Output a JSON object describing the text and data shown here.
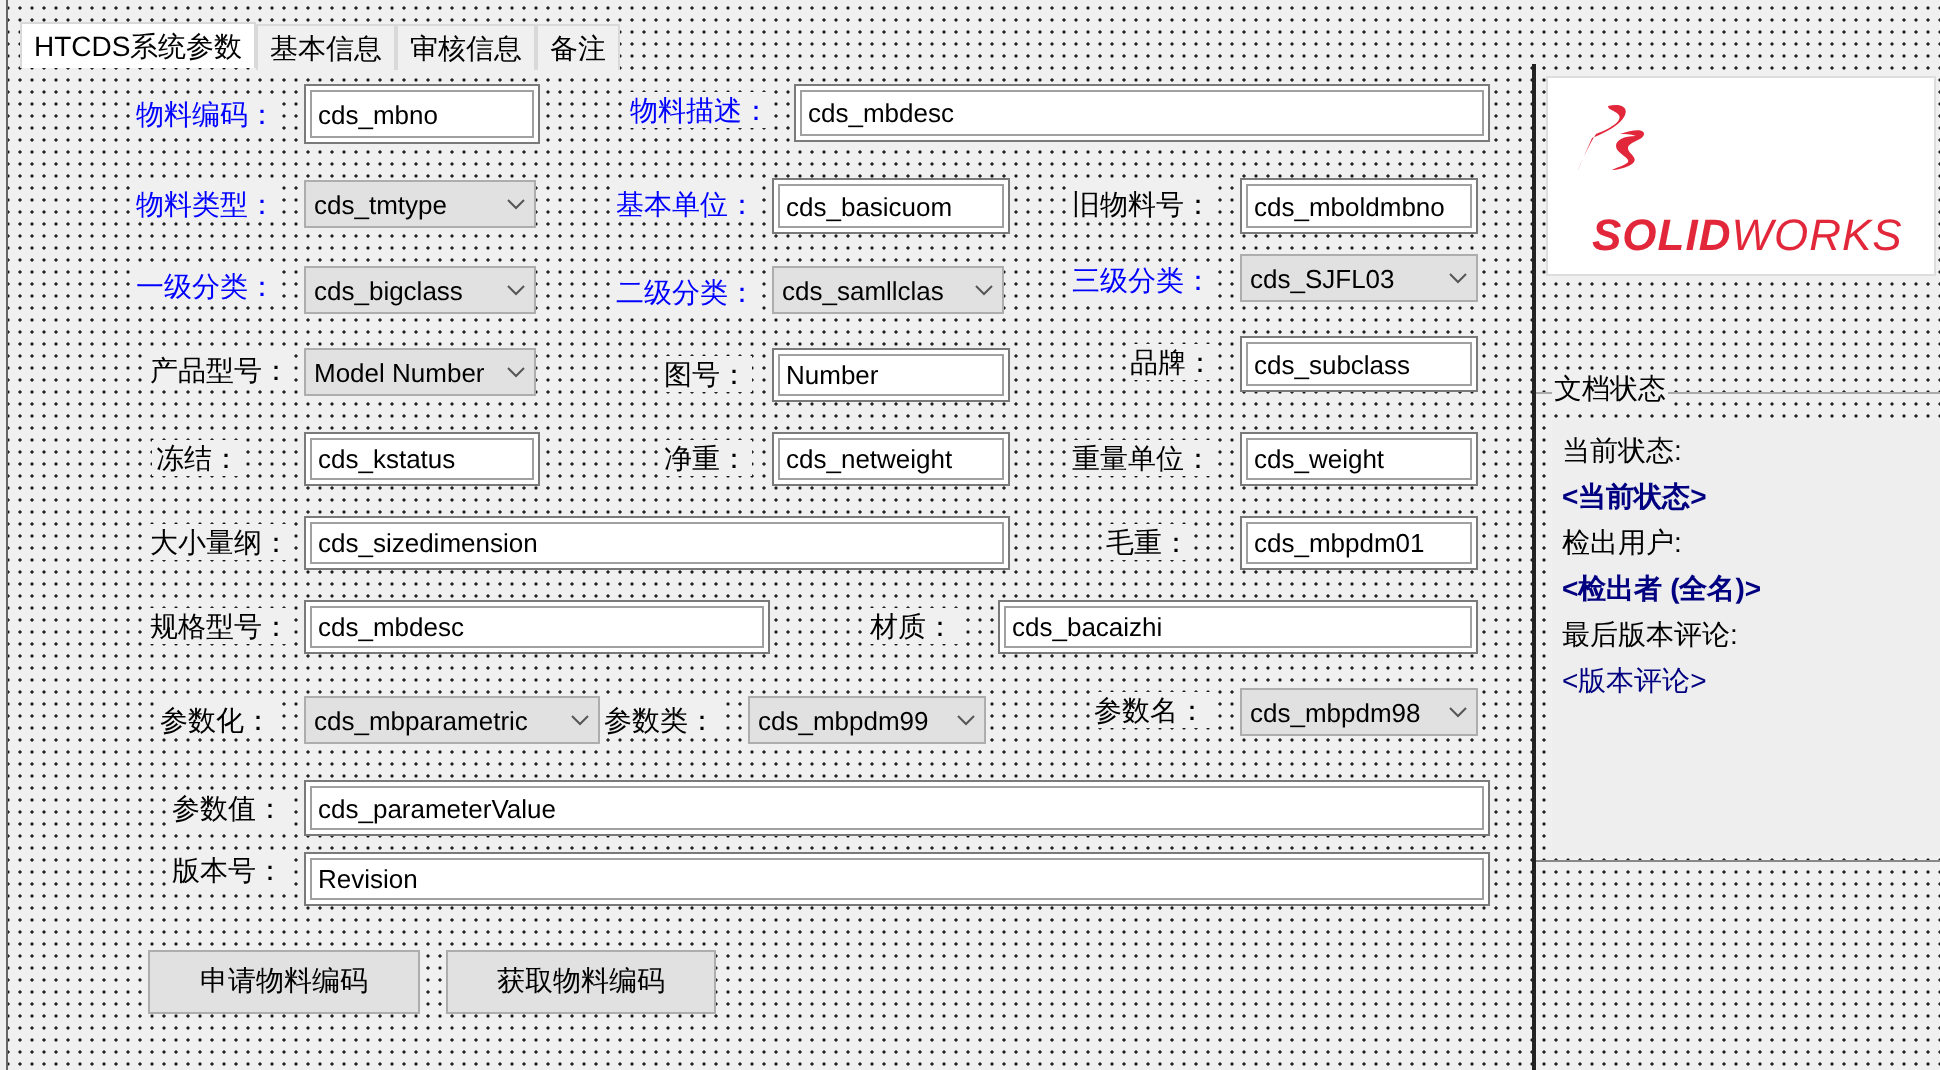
{
  "tabs": [
    {
      "label": "HTCDS系统参数",
      "selected": true
    },
    {
      "label": "基本信息",
      "selected": false
    },
    {
      "label": "审核信息",
      "selected": false
    },
    {
      "label": "备注",
      "selected": false
    }
  ],
  "fields": [
    {
      "label": "物料编码：",
      "required": true,
      "kind": "text",
      "value": "cds_mbno"
    },
    {
      "label": "物料描述：",
      "required": true,
      "kind": "text",
      "value": "cds_mbdesc"
    },
    {
      "label": "物料类型：",
      "required": true,
      "kind": "combo",
      "value": "cds_tmtype"
    },
    {
      "label": "基本单位：",
      "required": true,
      "kind": "text",
      "value": "cds_basicuom"
    },
    {
      "label": "旧物料号：",
      "required": false,
      "kind": "text",
      "value": "cds_mboldmbno"
    },
    {
      "label": "一级分类：",
      "required": true,
      "kind": "combo",
      "value": "cds_bigclass"
    },
    {
      "label": "二级分类：",
      "required": true,
      "kind": "combo",
      "value": "cds_samllclas"
    },
    {
      "label": "三级分类：",
      "required": true,
      "kind": "combo",
      "value": "cds_SJFL03"
    },
    {
      "label": "产品型号：",
      "required": false,
      "kind": "combo",
      "value": "Model Number"
    },
    {
      "label": "图号：",
      "required": false,
      "kind": "text",
      "value": "Number"
    },
    {
      "label": "品牌：",
      "required": false,
      "kind": "text",
      "value": "cds_subclass"
    },
    {
      "label": "冻结：",
      "required": false,
      "kind": "text",
      "value": "cds_kstatus"
    },
    {
      "label": "净重：",
      "required": false,
      "kind": "text",
      "value": "cds_netweight"
    },
    {
      "label": "重量单位：",
      "required": false,
      "kind": "text",
      "value": "cds_weight"
    },
    {
      "label": "大小量纲：",
      "required": false,
      "kind": "text",
      "value": "cds_sizedimension"
    },
    {
      "label": "毛重：",
      "required": false,
      "kind": "text",
      "value": "cds_mbpdm01"
    },
    {
      "label": "规格型号：",
      "required": false,
      "kind": "text",
      "value": "cds_mbdesc"
    },
    {
      "label": "材质：",
      "required": false,
      "kind": "text",
      "value": "cds_bacaizhi"
    },
    {
      "label": "参数化：",
      "required": false,
      "kind": "combo",
      "value": "cds_mbparametric"
    },
    {
      "label": "参数类：",
      "required": false,
      "kind": "combo",
      "value": "cds_mbpdm99"
    },
    {
      "label": "参数名：",
      "required": false,
      "kind": "combo",
      "value": "cds_mbpdm98"
    },
    {
      "label": "参数值：",
      "required": false,
      "kind": "text",
      "value": "cds_parameterValue"
    },
    {
      "label": "版本号：",
      "required": false,
      "kind": "text",
      "value": "Revision"
    }
  ],
  "buttons": [
    "申请物料编码",
    "获取物料编码"
  ],
  "logo": "**SOLID**WORKS",
  "status_group": {
    "title": "文档状态",
    "items": [
      {
        "kind": "label",
        "text": "当前状态:"
      },
      {
        "kind": "emphasis",
        "text": "<当前状态>"
      },
      {
        "kind": "label",
        "text": "检出用户:"
      },
      {
        "kind": "emphasis",
        "text": "<检出者 (全名)>"
      },
      {
        "kind": "label",
        "text": "最后版本评论:"
      },
      {
        "kind": "value",
        "text": "<版本评论>"
      }
    ]
  }
}
